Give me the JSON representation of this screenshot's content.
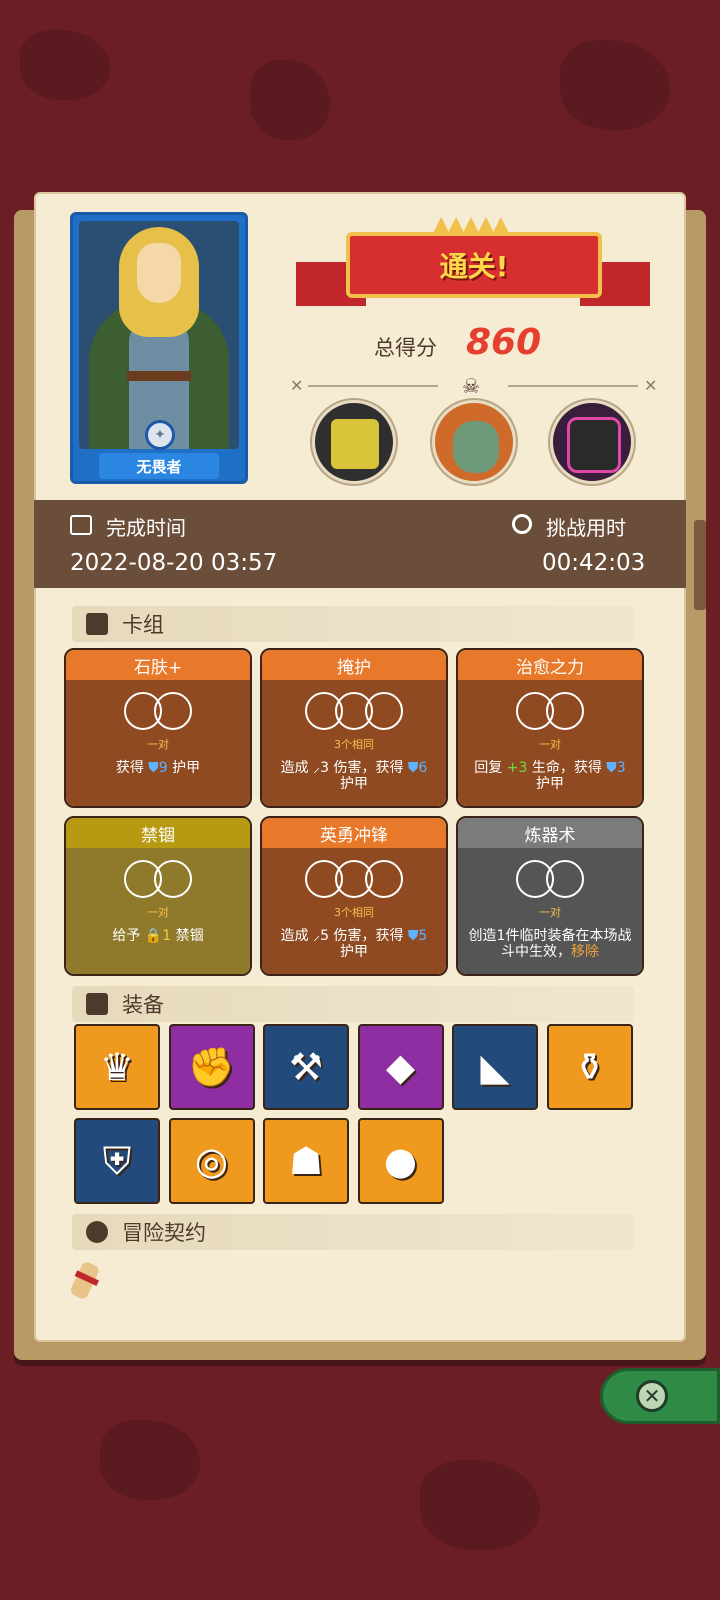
{
  "hero": {
    "name": "无畏者"
  },
  "result": {
    "banner": "通关!",
    "score_label": "总得分",
    "score": "860"
  },
  "info": {
    "completion_label": "完成时间",
    "completion_value": "2022-08-20 03:57",
    "duration_label": "挑战用时",
    "duration_value": "00:42:03"
  },
  "sections": {
    "deck": "卡组",
    "equipment": "装备",
    "contract": "冒险契约"
  },
  "cards": [
    {
      "title": "石肤+",
      "count_label": "一对",
      "desc_before": "获得 ",
      "desc_num": "9",
      "desc_after": " 护甲",
      "color": "#e8782a"
    },
    {
      "title": "掩护",
      "count_label": "3个相同",
      "desc_before": "造成 ",
      "desc_num": "3",
      "desc_mid": " 伤害，获得 ",
      "desc_num2": "6",
      "desc_after": " 护甲",
      "color": "#e8782a"
    },
    {
      "title": "治愈之力",
      "count_label": "一对",
      "desc_before": "回复 ",
      "desc_num": "+3",
      "desc_mid": " 生命，获得 ",
      "desc_num2": "3",
      "desc_after": " 护甲",
      "color": "#e8782a"
    },
    {
      "title": "禁锢",
      "count_label": "一对",
      "desc_before": "给予 ",
      "desc_num": "1",
      "desc_after": " 禁锢",
      "color": "#b89a12"
    },
    {
      "title": "英勇冲锋",
      "count_label": "3个相同",
      "desc_before": "造成 ",
      "desc_num": "5",
      "desc_mid": " 伤害，获得 ",
      "desc_num2": "5",
      "desc_after": " 护甲",
      "color": "#e8782a"
    },
    {
      "title": "炼器术",
      "count_label": "一对",
      "desc_before": "创造1件临时装备在本场战斗中生效，",
      "desc_hl": "移除",
      "color": "#7b7b7b"
    }
  ],
  "equipment": [
    {
      "icon": "crown-icon",
      "glyph": "♛",
      "bg": "orange"
    },
    {
      "icon": "fire-gauntlet-icon",
      "glyph": "✊",
      "bg": "purple"
    },
    {
      "icon": "scythe-icon",
      "glyph": "⚒",
      "bg": "blue"
    },
    {
      "icon": "crystal-gem-icon",
      "glyph": "◆",
      "bg": "purple"
    },
    {
      "icon": "boot-icon",
      "glyph": "◣",
      "bg": "blue"
    },
    {
      "icon": "jar-icon",
      "glyph": "⚱",
      "bg": "orange"
    },
    {
      "icon": "chest-armor-icon",
      "glyph": "⛨",
      "bg": "blue"
    },
    {
      "icon": "round-shield-icon",
      "glyph": "◎",
      "bg": "orange"
    },
    {
      "icon": "hood-icon",
      "glyph": "☗",
      "bg": "orange"
    },
    {
      "icon": "slime-icon",
      "glyph": "●",
      "bg": "orange"
    }
  ],
  "colors": {
    "background": "#6b1f24",
    "paper": "#f6ecd3",
    "band": "#6b4e3a",
    "score": "#e5402f"
  }
}
